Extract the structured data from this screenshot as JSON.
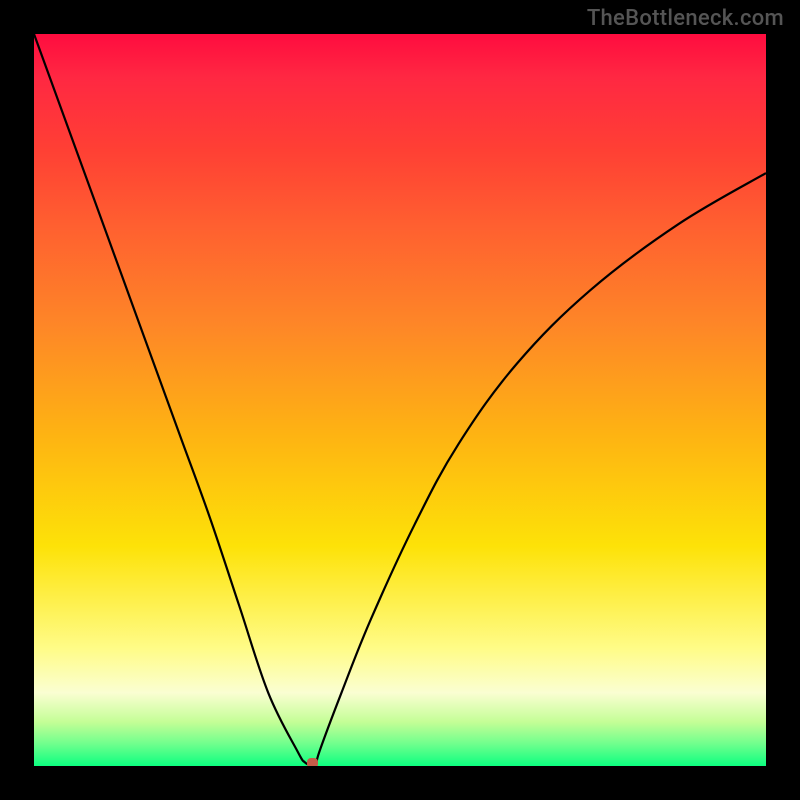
{
  "watermark_text": "TheBottleneck.com",
  "chart_data": {
    "type": "line",
    "title": "",
    "xlabel": "",
    "ylabel": "",
    "xlim": [
      0,
      100
    ],
    "ylim": [
      0,
      100
    ],
    "series": [
      {
        "name": "bottleneck-curve",
        "x": [
          0,
          4,
          8,
          12,
          16,
          20,
          24,
          28,
          32,
          36,
          37,
          38,
          38.5,
          39,
          42,
          46,
          52,
          58,
          66,
          76,
          88,
          100
        ],
        "values": [
          100,
          89,
          78,
          67,
          56,
          45,
          34,
          22,
          10,
          2,
          0.5,
          0,
          0,
          2,
          10,
          20,
          33,
          44,
          55,
          65,
          74,
          81
        ]
      }
    ],
    "minimum_marker": {
      "x": 38,
      "y": 0
    },
    "gradient_stops": [
      {
        "pct": 0,
        "color": "#ff0c3f"
      },
      {
        "pct": 6,
        "color": "#ff2842"
      },
      {
        "pct": 16,
        "color": "#ff4034"
      },
      {
        "pct": 26,
        "color": "#ff5f30"
      },
      {
        "pct": 40,
        "color": "#fe8727"
      },
      {
        "pct": 55,
        "color": "#feb412"
      },
      {
        "pct": 70,
        "color": "#fde208"
      },
      {
        "pct": 84,
        "color": "#fffc88"
      },
      {
        "pct": 90,
        "color": "#fafed2"
      },
      {
        "pct": 94,
        "color": "#c4fe96"
      },
      {
        "pct": 97,
        "color": "#6fff8d"
      },
      {
        "pct": 100,
        "color": "#0dff80"
      }
    ]
  },
  "colors": {
    "page_border": "#000000",
    "curve_stroke": "#000000",
    "marker_fill": "#c55c49"
  }
}
